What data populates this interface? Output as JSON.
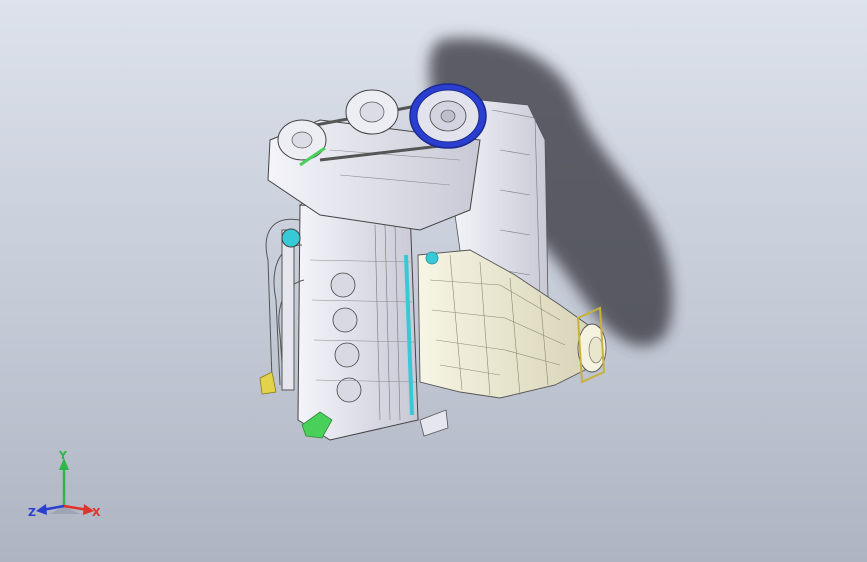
{
  "viewport": {
    "background_top": "#dde2ec",
    "background_bottom": "#aeb4c1"
  },
  "model": {
    "kind": "engine-assembly-3d-model",
    "body_color": "#e9e9f1",
    "intake_color": "#f1efd6",
    "pulley_accent": "#2a3fd0",
    "highlight_green": "#49d05a",
    "highlight_cyan": "#37c9d6",
    "highlight_yellow": "#e3d34a",
    "shadow_color": "#3d3d44"
  },
  "triad": {
    "x_label": "X",
    "y_label": "Y",
    "z_label": "Z",
    "x_color": "#e0312a",
    "y_color": "#2fb54a",
    "z_color": "#2a3fd0"
  }
}
